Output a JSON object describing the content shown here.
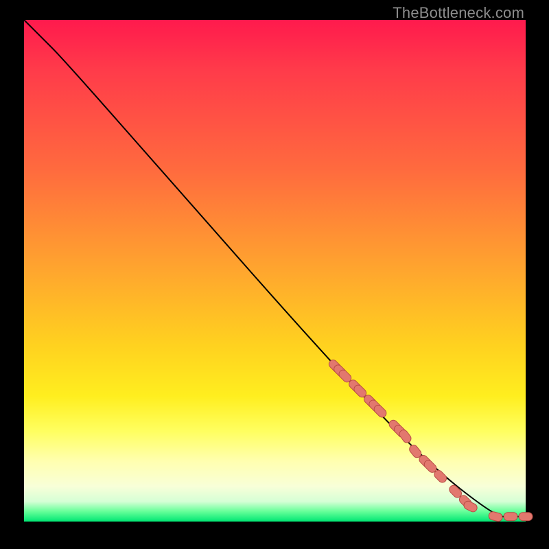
{
  "watermark": "TheBottleneck.com",
  "colors": {
    "marker_fill": "#e2786e",
    "marker_stroke": "#b84b44",
    "line": "#000000"
  },
  "chart_data": {
    "type": "line",
    "title": "",
    "xlabel": "",
    "ylabel": "",
    "xlim": [
      0,
      100
    ],
    "ylim": [
      0,
      100
    ],
    "grid": false,
    "legend": false,
    "line": {
      "x": [
        0,
        3,
        8,
        30,
        60,
        80,
        94,
        97,
        100
      ],
      "y": [
        100,
        97,
        92,
        67,
        33,
        12,
        1,
        1,
        1
      ]
    },
    "markers": {
      "x": [
        62,
        63,
        64,
        66,
        67,
        69,
        70,
        71,
        74,
        75,
        76,
        78,
        80,
        81,
        83,
        86,
        88,
        89,
        94,
        97,
        100
      ],
      "y": [
        31,
        30,
        29,
        27,
        26,
        24,
        23,
        22,
        19,
        18,
        17,
        14,
        12,
        11,
        9,
        6,
        4,
        3,
        1,
        1,
        1
      ]
    }
  }
}
